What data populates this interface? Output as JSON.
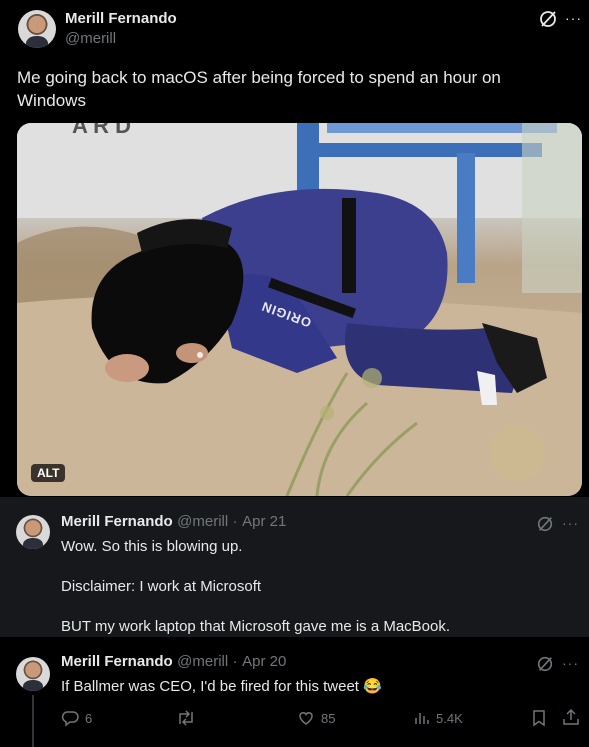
{
  "main_tweet": {
    "author_name": "Merill Fernando",
    "author_handle": "@merill",
    "text_line1": "Me going back to macOS after being forced to spend an hour on",
    "text_line2": "Windows",
    "alt_badge": "ALT",
    "photo_suit_text": "ORIGIN"
  },
  "reply1": {
    "author_name": "Merill Fernando",
    "author_handle": "@merill",
    "separator": "·",
    "date": "Apr 21",
    "line1": "Wow. So this is blowing up.",
    "line2": "Disclaimer: I work at Microsoft",
    "line3": "BUT my work laptop that Microsoft gave me is a MacBook."
  },
  "reply2": {
    "author_name": "Merill Fernando",
    "author_handle": "@merill",
    "separator": "·",
    "date": "Apr 20",
    "text": "If Ballmer was CEO, I'd be fired for this tweet 😂",
    "reply_count": "6",
    "like_count": "85",
    "view_count": "5.4K"
  },
  "icons": {
    "grok": "grok-icon",
    "more": "more-icon",
    "reply": "reply-icon",
    "retweet": "retweet-icon",
    "like": "like-icon",
    "views": "views-icon",
    "bookmark": "bookmark-icon",
    "share": "share-icon"
  },
  "colors": {
    "background": "#000000",
    "reply_background": "#16181c",
    "text": "#e7e9ea",
    "secondary": "#71767b"
  }
}
